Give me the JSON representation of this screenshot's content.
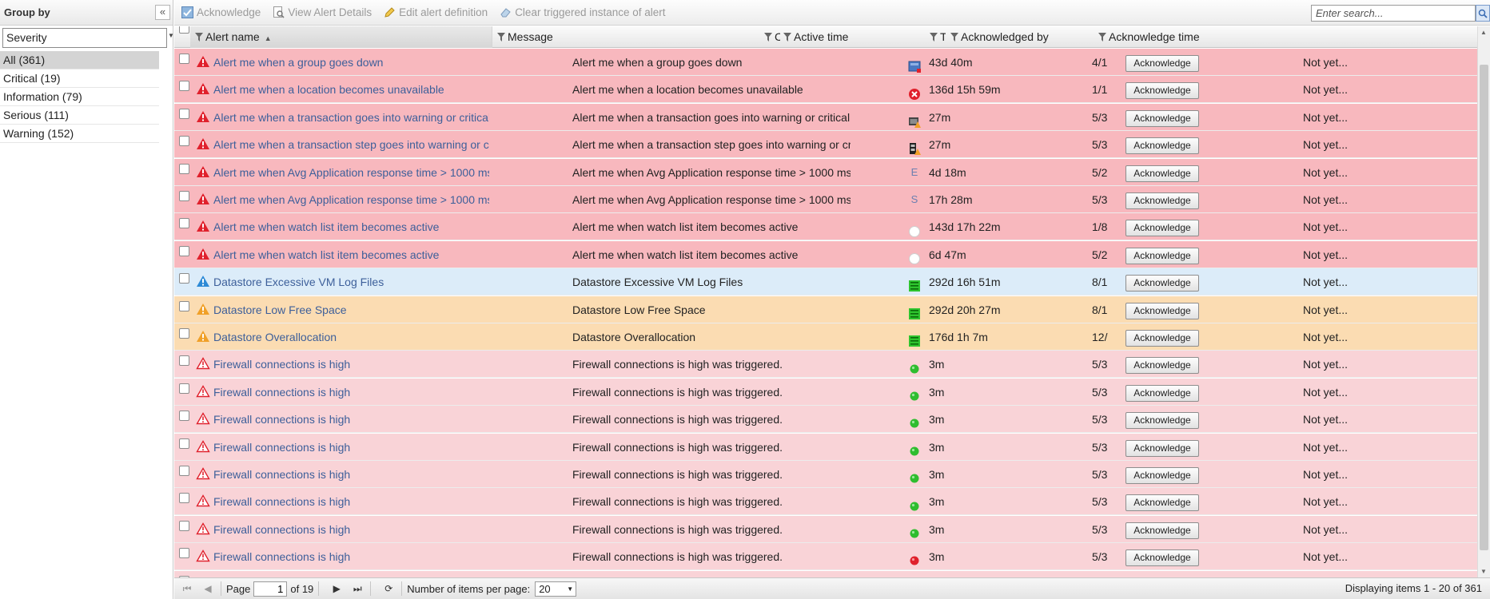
{
  "group_panel": {
    "title": "Group by",
    "collapse_glyph": "«",
    "select_value": "Severity",
    "items": [
      {
        "label": "All (361)",
        "selected": true
      },
      {
        "label": "Critical (19)",
        "selected": false
      },
      {
        "label": "Information (79)",
        "selected": false
      },
      {
        "label": "Serious (111)",
        "selected": false
      },
      {
        "label": "Warning (152)",
        "selected": false
      }
    ]
  },
  "toolbar": {
    "acknowledge": "Acknowledge",
    "view_details": "View Alert Details",
    "edit_definition": "Edit alert definition",
    "clear_triggered": "Clear triggered instance of alert",
    "search_placeholder": "Enter search..."
  },
  "columns": {
    "alert_name": "Alert name",
    "message": "Message",
    "object": "C",
    "active_time": "Active time",
    "count": "T",
    "ack_by": "Acknowledged by",
    "ack_time": "Acknowledge time"
  },
  "rows": [
    {
      "severity": "critical",
      "name": "Alert me when a group goes down",
      "message": "Alert me when a group goes down",
      "object_icon": "group-icon",
      "active": "43d 40m",
      "count": "4/1",
      "ack_label": "Acknowledge",
      "ack_time": "Not yet..."
    },
    {
      "severity": "critical",
      "name": "Alert me when a location becomes unavailable",
      "message": "Alert me when a location becomes unavailable",
      "object_icon": "error-circle-icon",
      "active": "136d 15h 59m",
      "count": "1/1",
      "ack_label": "Acknowledge",
      "ack_time": "Not yet..."
    },
    {
      "severity": "critical",
      "name": "Alert me when a transaction goes into warning or critical state",
      "message": "Alert me when a transaction goes into warning or critical state",
      "object_icon": "transaction-warning-icon",
      "active": "27m",
      "count": "5/3",
      "ack_label": "Acknowledge",
      "ack_time": "Not yet..."
    },
    {
      "severity": "critical",
      "name": "Alert me when a transaction step goes into warning or critical state",
      "message": "Alert me when a transaction step goes into warning or critical state",
      "object_icon": "transaction-step-icon",
      "active": "27m",
      "count": "5/3",
      "ack_label": "Acknowledge",
      "ack_time": "Not yet..."
    },
    {
      "severity": "critical",
      "name": "Alert me when Avg Application response time > 1000 ms",
      "message": "Alert me when Avg Application response time > 1000 ms",
      "object_icon": "letter-e-icon",
      "object_letter": "E",
      "active": "4d 18m",
      "count": "5/2",
      "ack_label": "Acknowledge",
      "ack_time": "Not yet..."
    },
    {
      "severity": "critical",
      "name": "Alert me when Avg Application response time > 1000 ms",
      "message": "Alert me when Avg Application response time > 1000 ms",
      "object_icon": "letter-s-icon",
      "object_letter": "S",
      "active": "17h 28m",
      "count": "5/3",
      "ack_label": "Acknowledge",
      "ack_time": "Not yet..."
    },
    {
      "severity": "critical",
      "name": "Alert me when watch list item becomes active",
      "message": "Alert me when watch list item becomes active",
      "object_icon": "white-circle-icon",
      "active": "143d 17h 22m",
      "count": "1/8",
      "ack_label": "Acknowledge",
      "ack_time": "Not yet..."
    },
    {
      "severity": "critical",
      "name": "Alert me when watch list item becomes active",
      "message": "Alert me when watch list item becomes active",
      "object_icon": "white-circle-icon",
      "active": "6d 47m",
      "count": "5/2",
      "ack_label": "Acknowledge",
      "ack_time": "Not yet..."
    },
    {
      "severity": "info",
      "name": "Datastore Excessive VM Log Files",
      "message": "Datastore Excessive VM Log Files",
      "object_icon": "datastore-icon",
      "active": "292d 16h 51m",
      "count": "8/1",
      "ack_label": "Acknowledge",
      "ack_time": "Not yet..."
    },
    {
      "severity": "warning",
      "name": "Datastore Low Free Space",
      "message": "Datastore Low Free Space",
      "object_icon": "datastore-icon",
      "active": "292d 20h 27m",
      "count": "8/1",
      "ack_label": "Acknowledge",
      "ack_time": "Not yet..."
    },
    {
      "severity": "warning",
      "name": "Datastore Overallocation",
      "message": "Datastore Overallocation",
      "object_icon": "datastore-icon",
      "active": "176d 1h 7m",
      "count": "12/",
      "ack_label": "Acknowledge",
      "ack_time": "Not yet..."
    },
    {
      "severity": "serious",
      "name": "Firewall connections is high",
      "message": "Firewall connections is high was triggered.",
      "object_icon": "green-dot-icon",
      "active": "3m",
      "count": "5/3",
      "ack_label": "Acknowledge",
      "ack_time": "Not yet..."
    },
    {
      "severity": "serious",
      "name": "Firewall connections is high",
      "message": "Firewall connections is high was triggered.",
      "object_icon": "green-dot-icon",
      "active": "3m",
      "count": "5/3",
      "ack_label": "Acknowledge",
      "ack_time": "Not yet..."
    },
    {
      "severity": "serious",
      "name": "Firewall connections is high",
      "message": "Firewall connections is high was triggered.",
      "object_icon": "green-dot-icon",
      "active": "3m",
      "count": "5/3",
      "ack_label": "Acknowledge",
      "ack_time": "Not yet..."
    },
    {
      "severity": "serious",
      "name": "Firewall connections is high",
      "message": "Firewall connections is high was triggered.",
      "object_icon": "green-dot-icon",
      "active": "3m",
      "count": "5/3",
      "ack_label": "Acknowledge",
      "ack_time": "Not yet..."
    },
    {
      "severity": "serious",
      "name": "Firewall connections is high",
      "message": "Firewall connections is high was triggered.",
      "object_icon": "green-dot-icon",
      "active": "3m",
      "count": "5/3",
      "ack_label": "Acknowledge",
      "ack_time": "Not yet..."
    },
    {
      "severity": "serious",
      "name": "Firewall connections is high",
      "message": "Firewall connections is high was triggered.",
      "object_icon": "green-dot-icon",
      "active": "3m",
      "count": "5/3",
      "ack_label": "Acknowledge",
      "ack_time": "Not yet..."
    },
    {
      "severity": "serious",
      "name": "Firewall connections is high",
      "message": "Firewall connections is high was triggered.",
      "object_icon": "green-dot-icon",
      "active": "3m",
      "count": "5/3",
      "ack_label": "Acknowledge",
      "ack_time": "Not yet..."
    },
    {
      "severity": "serious",
      "name": "Firewall connections is high",
      "message": "Firewall connections is high was triggered.",
      "object_icon": "red-dot-icon",
      "active": "3m",
      "count": "5/3",
      "ack_label": "Acknowledge",
      "ack_time": "Not yet..."
    },
    {
      "severity": "serious",
      "name": "Firewall connections is high",
      "message": "Firewall connections is high was triggered.",
      "object_icon": "green-dot-icon",
      "active": "3m",
      "count": "5/3",
      "ack_label": "Acknowledge",
      "ack_time": "Not yet..."
    }
  ],
  "pager": {
    "page_label": "Page",
    "page_value": "1",
    "of_label": "of 19",
    "items_per_page_label": "Number of items per page:",
    "items_per_page": "20",
    "display_text": "Displaying items 1 - 20 of 361"
  },
  "colors": {
    "critical_row": "#f8b8be",
    "info_row": "#dcecf9",
    "warning_row": "#fbdcb2",
    "serious_row": "#f9d3d7",
    "link": "#3d5f9a"
  }
}
